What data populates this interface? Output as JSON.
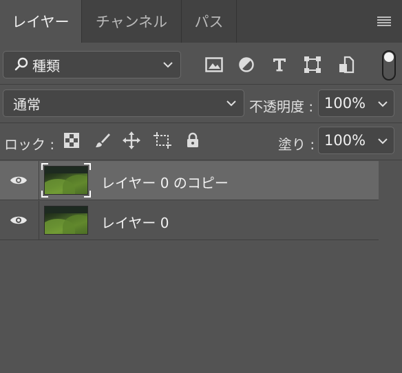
{
  "tabs": [
    {
      "label": "レイヤー",
      "active": true
    },
    {
      "label": "チャンネル",
      "active": false
    },
    {
      "label": "パス",
      "active": false
    }
  ],
  "filter": {
    "kind_label": "種類",
    "icons": [
      "image-filter-icon",
      "adjustment-filter-icon",
      "type-filter-icon",
      "shape-filter-icon",
      "smart-object-filter-icon"
    ]
  },
  "blend": {
    "mode": "通常",
    "opacity_label": "不透明度 :",
    "opacity_value": "100%"
  },
  "lock": {
    "label": "ロック :",
    "icons": [
      "lock-transparent-pixels-icon",
      "lock-image-pixels-icon",
      "lock-position-icon",
      "lock-artboard-icon",
      "lock-all-icon"
    ],
    "fill_label": "塗り :",
    "fill_value": "100%"
  },
  "layers": [
    {
      "name": "レイヤー 0 のコピー",
      "visible": true,
      "selected": true
    },
    {
      "name": "レイヤー 0",
      "visible": true,
      "selected": false
    }
  ],
  "colors": {
    "panel_bg": "#535353",
    "tabbar_bg": "#424242",
    "selected_row": "#686868",
    "field_bg": "#464646"
  }
}
